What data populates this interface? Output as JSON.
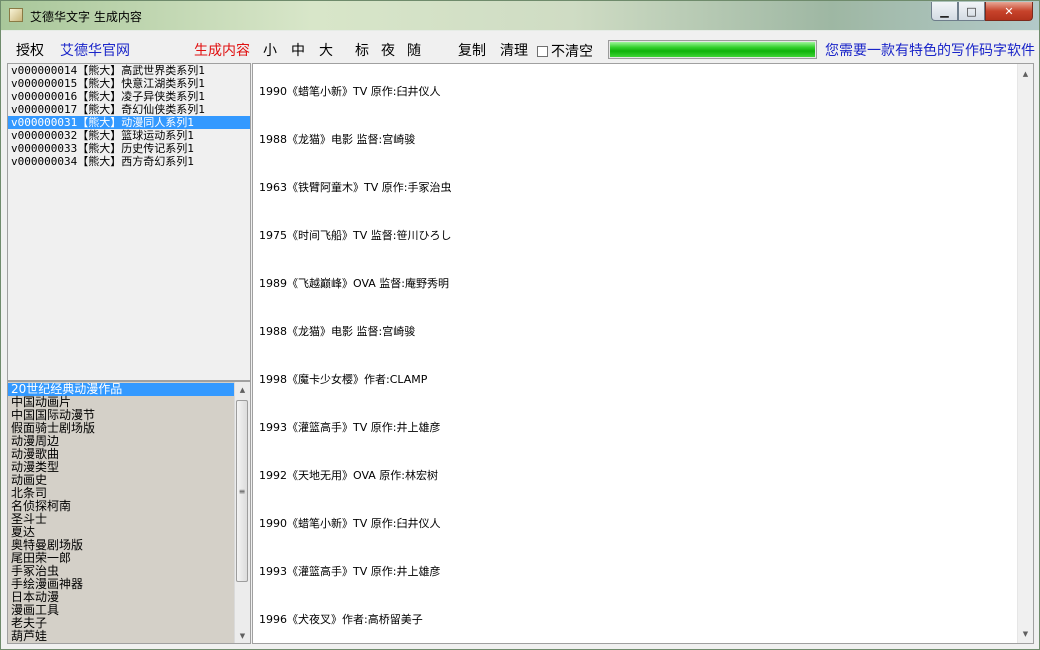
{
  "window": {
    "title": "艾德华文字 生成内容",
    "controls": {
      "minimize": "▁",
      "maximize": "□",
      "close": "✕"
    }
  },
  "toolbar": {
    "authorize": "授权",
    "official_site": "艾德华官网",
    "generate": "生成内容",
    "size_small": "小",
    "size_medium": "中",
    "size_large": "大",
    "mode_mark": "标",
    "mode_night": "夜",
    "mode_random": "随",
    "copy": "复制",
    "clear": "清理",
    "no_clear_label": "不清空",
    "no_clear_checked": false,
    "progress_fraction": 1.0,
    "promo": "您需要一款有特色的写作码字软件"
  },
  "series_list": [
    {
      "text": "v000000014【熊大】高武世界类系列1",
      "selected": false
    },
    {
      "text": "v000000015【熊大】快意江湖类系列1",
      "selected": false
    },
    {
      "text": "v000000016【熊大】凌子异侠类系列1",
      "selected": false
    },
    {
      "text": "v000000017【熊大】奇幻仙侠类系列1",
      "selected": false
    },
    {
      "text": "v000000031【熊大】动漫同人系列1",
      "selected": true
    },
    {
      "text": "v000000032【熊大】篮球运动系列1",
      "selected": false
    },
    {
      "text": "v000000033【熊大】历史传记系列1",
      "selected": false
    },
    {
      "text": "v000000034【熊大】西方奇幻系列1",
      "selected": false
    }
  ],
  "category_list": [
    {
      "text": "20世纪经典动漫作品",
      "selected": true
    },
    {
      "text": "中国动画片",
      "selected": false
    },
    {
      "text": "中国国际动漫节",
      "selected": false
    },
    {
      "text": "假面骑士剧场版",
      "selected": false
    },
    {
      "text": "动漫周边",
      "selected": false
    },
    {
      "text": "动漫歌曲",
      "selected": false
    },
    {
      "text": "动漫类型",
      "selected": false
    },
    {
      "text": "动画史",
      "selected": false
    },
    {
      "text": "北条司",
      "selected": false
    },
    {
      "text": "名侦探柯南",
      "selected": false
    },
    {
      "text": "圣斗士",
      "selected": false
    },
    {
      "text": "夏达",
      "selected": false
    },
    {
      "text": "奥特曼剧场版",
      "selected": false
    },
    {
      "text": "尾田荣一郎",
      "selected": false
    },
    {
      "text": "手冢治虫",
      "selected": false
    },
    {
      "text": "手绘漫画神器",
      "selected": false
    },
    {
      "text": "日本动漫",
      "selected": false
    },
    {
      "text": "漫画工具",
      "selected": false
    },
    {
      "text": "老夫子",
      "selected": false
    },
    {
      "text": "葫芦娃",
      "selected": false
    }
  ],
  "content_lines": [
    "1990《蜡笔小新》TV 原作:臼井仪人",
    "1988《龙猫》电影 监督:宫崎骏",
    "1963《铁臂阿童木》TV 原作:手冢治虫",
    "1975《时间飞船》TV 监督:笹川ひろし",
    "1989《飞越巅峰》OVA 监督:庵野秀明",
    "1988《龙猫》电影 监督:宫崎骏",
    "1998《魔卡少女樱》作者:CLAMP",
    "1993《灌篮高手》TV 原作:井上雄彦",
    "1992《天地无用》OVA 原作:林宏树",
    "1990《蜡笔小新》TV 原作:臼井仪人",
    "1993《灌篮高手》TV 原作:井上雄彦",
    "1996《犬夜叉》作者:高桥留美子"
  ],
  "scrollbar": {
    "up": "▲",
    "down": "▼",
    "grip": "≡"
  }
}
